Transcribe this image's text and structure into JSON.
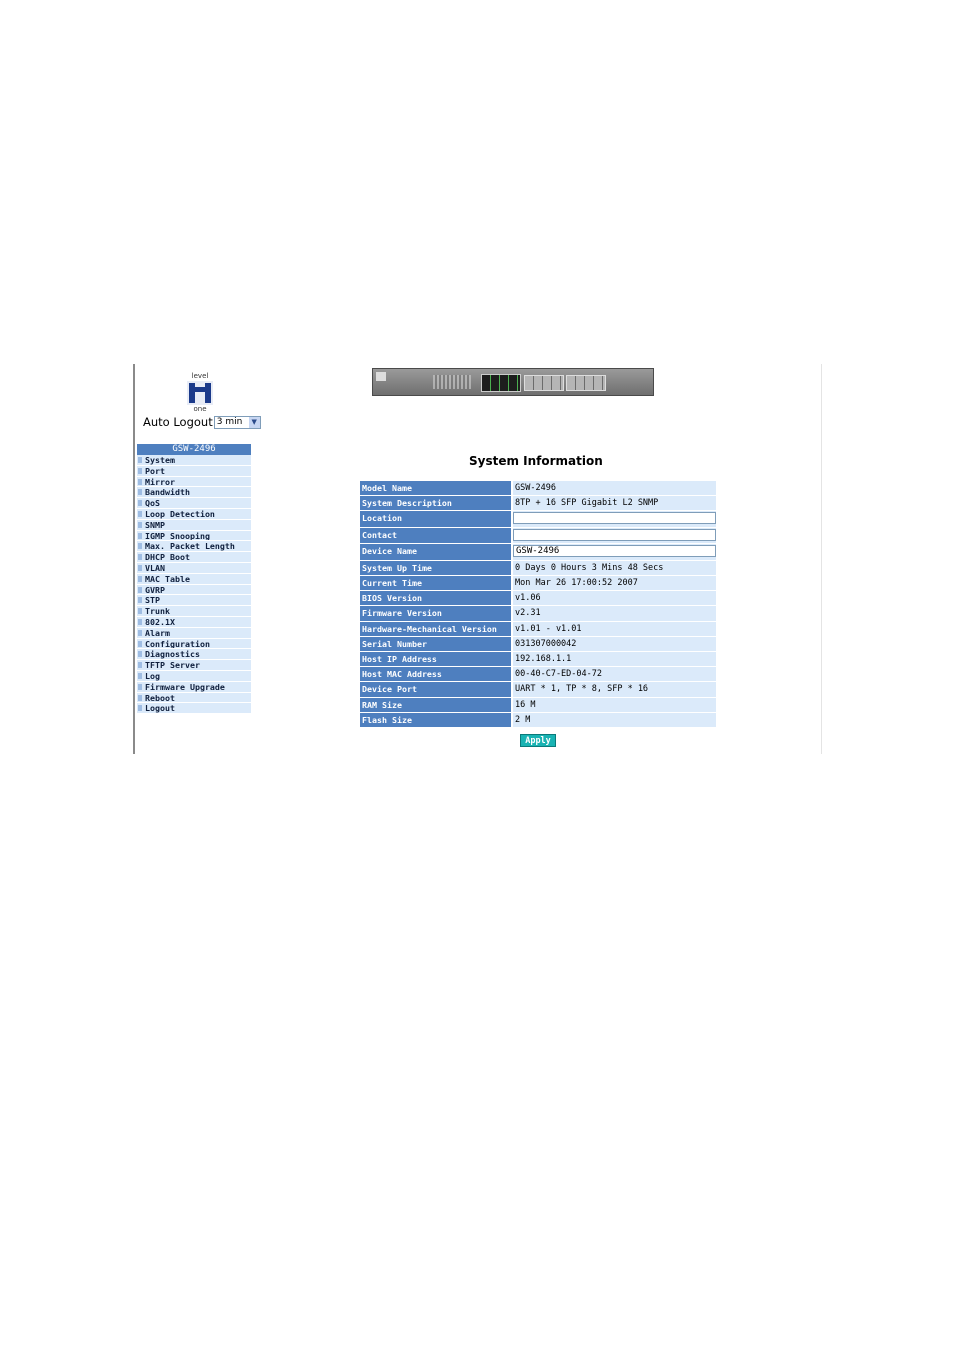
{
  "logo": {
    "top_text": "level",
    "bottom_text": "one"
  },
  "auto_logout": {
    "label": "Auto Logout",
    "selected": "3 min"
  },
  "sidebar": {
    "header": "GSW-2496",
    "items": [
      "System",
      "Port",
      "Mirror",
      "Bandwidth",
      "QoS",
      "Loop Detection",
      "SNMP",
      "IGMP Snooping",
      "Max. Packet Length",
      "DHCP Boot",
      "VLAN",
      "MAC Table",
      "GVRP",
      "STP",
      "Trunk",
      "802.1X",
      "Alarm",
      "Configuration",
      "Diagnostics",
      "TFTP Server",
      "Log",
      "Firmware Upgrade",
      "Reboot",
      "Logout"
    ]
  },
  "main": {
    "title": "System Information",
    "rows": [
      {
        "label": "Model Name",
        "value": "GSW-2496"
      },
      {
        "label": "System Description",
        "value": "8TP + 16 SFP Gigabit L2 SNMP"
      },
      {
        "label": "Location",
        "value": ""
      },
      {
        "label": "Contact",
        "value": ""
      },
      {
        "label": "Device Name",
        "value": "GSW-2496"
      },
      {
        "label": "System Up Time",
        "value": "0 Days 0 Hours 3 Mins 48 Secs"
      },
      {
        "label": "Current Time",
        "value": "Mon Mar 26 17:00:52 2007"
      },
      {
        "label": "BIOS Version",
        "value": "v1.06"
      },
      {
        "label": "Firmware Version",
        "value": "v2.31"
      },
      {
        "label": "Hardware-Mechanical Version",
        "value": "v1.01 - v1.01"
      },
      {
        "label": "Serial Number",
        "value": "031307000042"
      },
      {
        "label": "Host IP Address",
        "value": "192.168.1.1"
      },
      {
        "label": "Host MAC Address",
        "value": "00-40-C7-ED-04-72"
      },
      {
        "label": "Device Port",
        "value": "UART * 1, TP * 8, SFP * 16"
      },
      {
        "label": "RAM Size",
        "value": "16 M"
      },
      {
        "label": "Flash Size",
        "value": "2 M"
      }
    ],
    "apply_label": "Apply"
  },
  "colors": {
    "header_blue": "#4e7fbf",
    "cell_light": "#dbeafa",
    "apply": "#19b3b3"
  }
}
